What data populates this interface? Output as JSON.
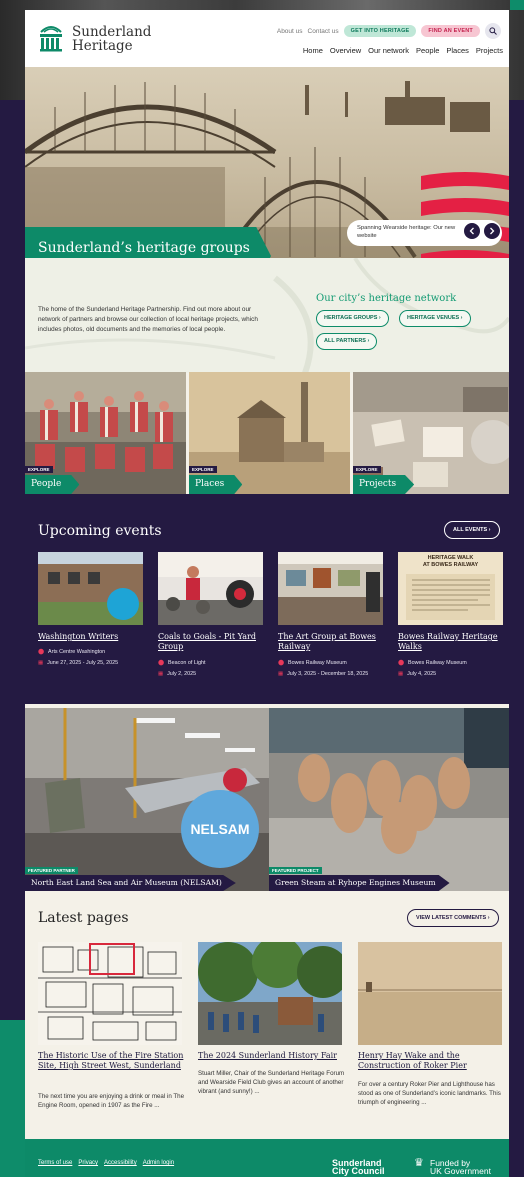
{
  "brand": {
    "name_line1": "Sunderland",
    "name_line2": "Heritage"
  },
  "header": {
    "top_links": [
      "About us",
      "Contact us"
    ],
    "get_into_heritage": "GET INTO HERITAGE",
    "find_an_event": "FIND AN EVENT",
    "nav": [
      "Home",
      "Overview",
      "Our network",
      "People",
      "Places",
      "Projects"
    ]
  },
  "hero": {
    "heading": "Sunderland’s heritage groups and venues working together",
    "slide_caption": "Spanning Wearside heritage: Our new website"
  },
  "intro": {
    "text": "The home of the Sunderland Heritage Partnership. Find out more about our network of partners and browse our collection of local heritage projects, which includes photos, old documents and the memories of local people.",
    "network_title": "Our city’s heritage network",
    "buttons": [
      "HERITAGE GROUPS",
      "HERITAGE VENUES",
      "ALL PARTNERS"
    ]
  },
  "explore": {
    "tag": "EXPLORE",
    "items": [
      "People",
      "Places",
      "Projects"
    ]
  },
  "events": {
    "title": "Upcoming events",
    "all_button": "ALL EVENTS",
    "items": [
      {
        "title": "Washington Writers",
        "venue": "Arts Centre Washington",
        "date": "June 27, 2025 - July 25, 2025"
      },
      {
        "title": "Coals to Goals - Pit Yard Group",
        "venue": "Beacon of Light",
        "date": "July 2, 2025"
      },
      {
        "title": "The Art Group at Bowes Railway",
        "venue": "Bowes Railway Museum",
        "date": "July 3, 2025 - December 18, 2025"
      },
      {
        "title": "Bowes Railway Heritage Walks",
        "venue": "Bowes Railway Museum",
        "date": "July 4, 2025"
      }
    ],
    "poster_text": [
      "HERITAGE WALK",
      "AT BOWES RAILWAY"
    ]
  },
  "featured": [
    {
      "tag": "FEATURED PARTNER",
      "label": "North East Land Sea and Air Museum (NELSAM)",
      "logo_text": "NELSAM"
    },
    {
      "tag": "FEATURED PROJECT",
      "label": "Green Steam at Ryhope Engines Museum"
    }
  ],
  "latest": {
    "title": "Latest pages",
    "button": "VIEW LATEST COMMENTS",
    "items": [
      {
        "title": "The Historic Use of the Fire Station Site, High Street West, Sunderland",
        "desc": "The next time you are enjoying a drink or meal in The Engine Room, opened in 1907 as the Fire ..."
      },
      {
        "title": "The 2024 Sunderland History Fair",
        "desc": "Stuart Miller, Chair of the Sunderland Heritage Forum and Wearside Field Club gives an account of another vibrant (and sunny!) ..."
      },
      {
        "title": "Henry Hay Wake and the Construction of Roker Pier",
        "desc": "For over a century Roker Pier and Lighthouse has stood as one of Sunderland’s iconic landmarks. This triumph of engineering ..."
      }
    ]
  },
  "footer": {
    "links": [
      "Terms of use",
      "Privacy",
      "Accessibility",
      "Admin login"
    ],
    "council_line1": "Sunderland",
    "council_line2": "City Council",
    "funded_line1": "Funded by",
    "funded_line2": "UK Government"
  },
  "colors": {
    "brand_green": "#0d8a68",
    "navy": "#241a42",
    "accent_red": "#e8385a",
    "pink_pill": "#f7c6d2",
    "green_pill": "#bfe7d7"
  },
  "icons": [
    "search-icon",
    "chevron-left-icon",
    "chevron-right-icon",
    "location-pin-icon",
    "calendar-icon",
    "chevron-right-icon"
  ]
}
